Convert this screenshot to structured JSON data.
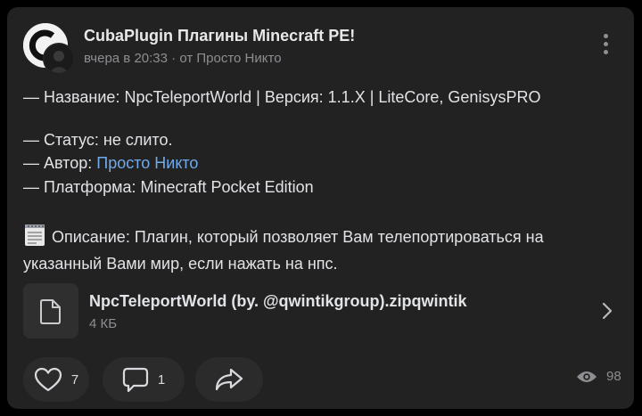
{
  "post": {
    "group_name": "CubaPlugin Плагины Minecraft PE!",
    "time": "вчера в 20:33",
    "meta_sep": " · от ",
    "author": "Просто Никто",
    "avatar_letter": "C"
  },
  "content": {
    "line_name": "— Название: NpcTeleportWorld | Версия: 1.1.X | LiteCore, GenisysPRO",
    "status": "— Статус: не слито.",
    "author_label": "— Автор: ",
    "author_link": "Просто Никто",
    "platform": "— Платформа: Minecraft Pocket Edition",
    "description": "Описание: Плагин, который позволяет Вам телепортироваться на указанный Вами мир, если нажать на нпс."
  },
  "attachment": {
    "file_name": "NpcTeleportWorld (by. @qwintikgroup).zipqwintik",
    "file_size": "4 КБ"
  },
  "actions": {
    "likes": "7",
    "comments": "1",
    "views": "98"
  },
  "icons": {
    "more": "more-vertical-icon",
    "memo": "memo-icon",
    "file": "file-icon",
    "chevron": "chevron-right-icon",
    "like": "heart-icon",
    "comment": "comment-icon",
    "share": "share-icon",
    "views": "eye-icon"
  },
  "colors": {
    "background": "#000000",
    "card": "#222222",
    "link": "#71aaeb",
    "muted": "#8c8e92"
  }
}
